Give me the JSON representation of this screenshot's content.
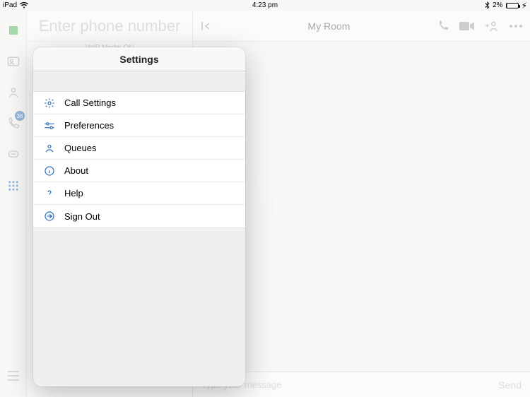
{
  "status_bar": {
    "device": "iPad",
    "time": "4:23 pm",
    "battery_pct": "2%"
  },
  "dialer": {
    "placeholder": "Enter phone number",
    "voip_label": "VoIP Mode: ON"
  },
  "rail": {
    "call_badge": "36"
  },
  "room": {
    "title": "My Room"
  },
  "compose": {
    "placeholder": "Type your message",
    "send_label": "Send"
  },
  "settings": {
    "title": "Settings",
    "items": [
      {
        "label": "Call Settings"
      },
      {
        "label": "Preferences"
      },
      {
        "label": "Queues"
      },
      {
        "label": "About"
      },
      {
        "label": "Help"
      },
      {
        "label": "Sign Out"
      }
    ]
  }
}
